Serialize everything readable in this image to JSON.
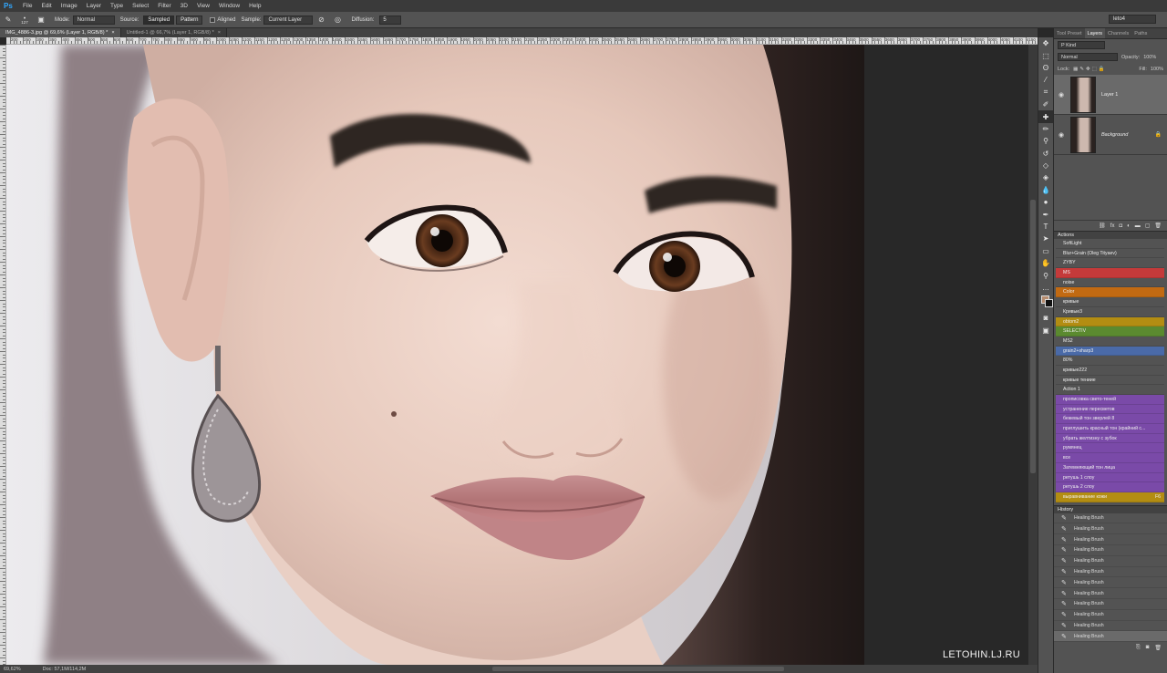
{
  "app": {
    "logo": "Ps"
  },
  "menu": [
    "File",
    "Edit",
    "Image",
    "Layer",
    "Type",
    "Select",
    "Filter",
    "3D",
    "View",
    "Window",
    "Help"
  ],
  "options": {
    "brush_size": "127",
    "mode_label": "Mode:",
    "mode_value": "Normal",
    "source_label": "Source:",
    "source_sampled": "Sampled",
    "source_pattern": "Pattern",
    "aligned_label": "Aligned",
    "sample_label": "Sample:",
    "sample_value": "Current Layer",
    "diffusion_label": "Diffusion:",
    "diffusion_value": "5",
    "workspace": "leto4"
  },
  "tabs": [
    {
      "label": "IMG_4886-3.jpg @ 69,6% (Layer 1, RGB/8) *",
      "close": "×"
    },
    {
      "label": "Untitled-1 @ 66,7% (Layer 1, RGB/8) *",
      "close": "×"
    }
  ],
  "ruler_labels": [
    "200",
    "250",
    "300",
    "350",
    "400",
    "450",
    "500",
    "550",
    "600",
    "650",
    "700",
    "750",
    "800",
    "850",
    "900",
    "950",
    "1000",
    "1050",
    "1100",
    "1150",
    "1200",
    "1250",
    "1300",
    "1350",
    "1400",
    "1450",
    "1500",
    "1550",
    "1600",
    "1650",
    "1700",
    "1750",
    "1800",
    "1850",
    "1900",
    "1950",
    "2000",
    "2050",
    "2100",
    "2150",
    "2200",
    "2250",
    "2300",
    "2350",
    "2400",
    "2450",
    "2500",
    "2550",
    "2600",
    "2650",
    "2700",
    "2750",
    "2800",
    "2850",
    "2900",
    "2950",
    "3000",
    "3050",
    "3100",
    "3150",
    "3200",
    "3250",
    "3300",
    "3350",
    "3400",
    "3450",
    "3500",
    "3550",
    "3600",
    "3650",
    "3700",
    "3750",
    "3800",
    "3850",
    "3900",
    "3950",
    "4000",
    "4050",
    "4100",
    "4150"
  ],
  "status": {
    "zoom": "69,62%",
    "doc": "Doc: 57,1M/114,2M"
  },
  "watermark": "LETOHIN.LJ.RU",
  "panel_tabs": [
    "Tool Preset",
    "Layers",
    "Channels",
    "Paths"
  ],
  "layers_panel": {
    "kind": "P Kind",
    "blend": "Normal",
    "opacity_label": "Opacity:",
    "opacity": "100%",
    "lock_label": "Lock:",
    "fill_label": "Fill:",
    "fill": "100%",
    "layers": [
      {
        "name": "Layer 1",
        "active": true
      },
      {
        "name": "Background",
        "active": false
      }
    ]
  },
  "actions": {
    "title": "Actions",
    "items": [
      {
        "label": "SoftLight",
        "color": ""
      },
      {
        "label": "Blur+Grain (Oleg Tityaev)",
        "color": ""
      },
      {
        "label": "ZYBY",
        "color": ""
      },
      {
        "label": "MS",
        "color": "#c53a3a"
      },
      {
        "label": "noise",
        "color": ""
      },
      {
        "label": "Color",
        "color": "#c26a12"
      },
      {
        "label": "кривые",
        "color": ""
      },
      {
        "label": "Кривые3",
        "color": ""
      },
      {
        "label": "obtom2",
        "color": "#b38d12"
      },
      {
        "label": "SELECTIV",
        "color": "#5b8a2f"
      },
      {
        "label": "MS2",
        "color": ""
      },
      {
        "label": "grain2+sharp3",
        "color": "#4a6aa8"
      },
      {
        "label": "80%",
        "color": ""
      },
      {
        "label": "кривые222",
        "color": ""
      },
      {
        "label": "кривые тениие",
        "color": ""
      },
      {
        "label": "Action 1",
        "color": ""
      },
      {
        "label": "прописовка свето-теней",
        "color": "#7a4aa8"
      },
      {
        "label": "устранение пересветов",
        "color": "#7a4aa8"
      },
      {
        "label": "бежевый тон зверлей 8",
        "color": "#7a4aa8"
      },
      {
        "label": "приглушить красный тон (крайний с...",
        "color": "#7a4aa8"
      },
      {
        "label": "убрать желтизну с зубок",
        "color": "#7a4aa8"
      },
      {
        "label": "румянец",
        "color": "#7a4aa8"
      },
      {
        "label": "все",
        "color": "#7a4aa8"
      },
      {
        "label": "Затемняющий тон лица",
        "color": "#7a4aa8"
      },
      {
        "label": "ретушь 1 cлоу",
        "color": "#7a4aa8"
      },
      {
        "label": "ретушь 2 cлоу",
        "color": "#7a4aa8"
      },
      {
        "label": "выравнивание кожи",
        "color": "#b38d12",
        "fkey": "F6"
      }
    ]
  },
  "history": {
    "title": "History",
    "items": [
      "Healing Brush",
      "Healing Brush",
      "Healing Brush",
      "Healing Brush",
      "Healing Brush",
      "Healing Brush",
      "Healing Brush",
      "Healing Brush",
      "Healing Brush",
      "Healing Brush",
      "Healing Brush",
      "Healing Brush"
    ]
  }
}
